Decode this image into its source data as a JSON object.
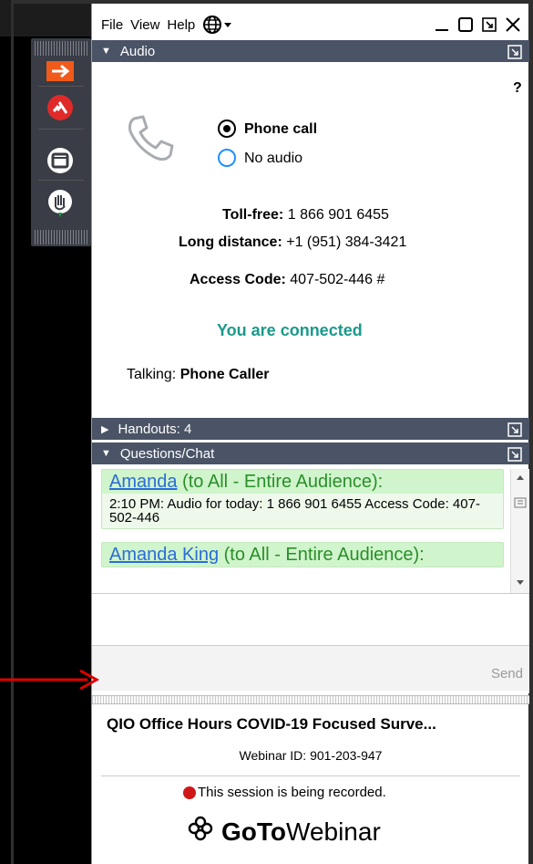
{
  "menu": {
    "file": "File",
    "view": "View",
    "help": "Help"
  },
  "audio": {
    "section_label": "Audio",
    "help": "?",
    "option_phone": "Phone call",
    "option_none": "No audio",
    "selected": "Phone call",
    "tollfree_label": "Toll-free:",
    "tollfree_value": "1 866 901 6455",
    "longdistance_label": "Long distance:",
    "longdistance_value": "+1 (951) 384-3421",
    "access_label": "Access Code:",
    "access_value": "407-502-446 #",
    "status": "You are connected",
    "talking_label": "Talking:",
    "talking_value": "Phone Caller"
  },
  "handouts": {
    "label": "Handouts: 4"
  },
  "chat": {
    "label": "Questions/Chat",
    "messages": [
      {
        "sender": "Amanda",
        "audience": " (to All - Entire Audience):",
        "body": "2:10 PM: Audio for today: 1 866 901 6455 Access Code: 407-502-446"
      },
      {
        "sender": "Amanda King",
        "audience": " (to All - Entire Audience):",
        "body": ""
      }
    ],
    "send_label": "Send"
  },
  "footer": {
    "webinar_title": "QIO Office Hours COVID-19 Focused Surve...",
    "webinar_id": "Webinar ID: 901-203-947",
    "recording": "This session is being recorded.",
    "brand_bold": "GoTo",
    "brand_light": "Webinar"
  },
  "colors": {
    "section_bar": "#4a5466",
    "connected_text": "#1a9a8a",
    "chat_bubble": "#d0f4cc",
    "link": "#2a6dd8",
    "record_dot": "#d01717",
    "grab_tab": "#3a3d46",
    "annotation_arrow": "#e00000"
  },
  "icons": {
    "grab_tab": [
      "exit-arrow-icon",
      "hangup-icon",
      "screen-icon",
      "raise-hand-icon"
    ],
    "window": [
      "minimize-icon",
      "maximize-icon",
      "restore-icon",
      "close-icon"
    ],
    "menu": "globe-icon",
    "audio": "phone-handset-icon",
    "brand": "gotowebinar-logo-icon"
  }
}
